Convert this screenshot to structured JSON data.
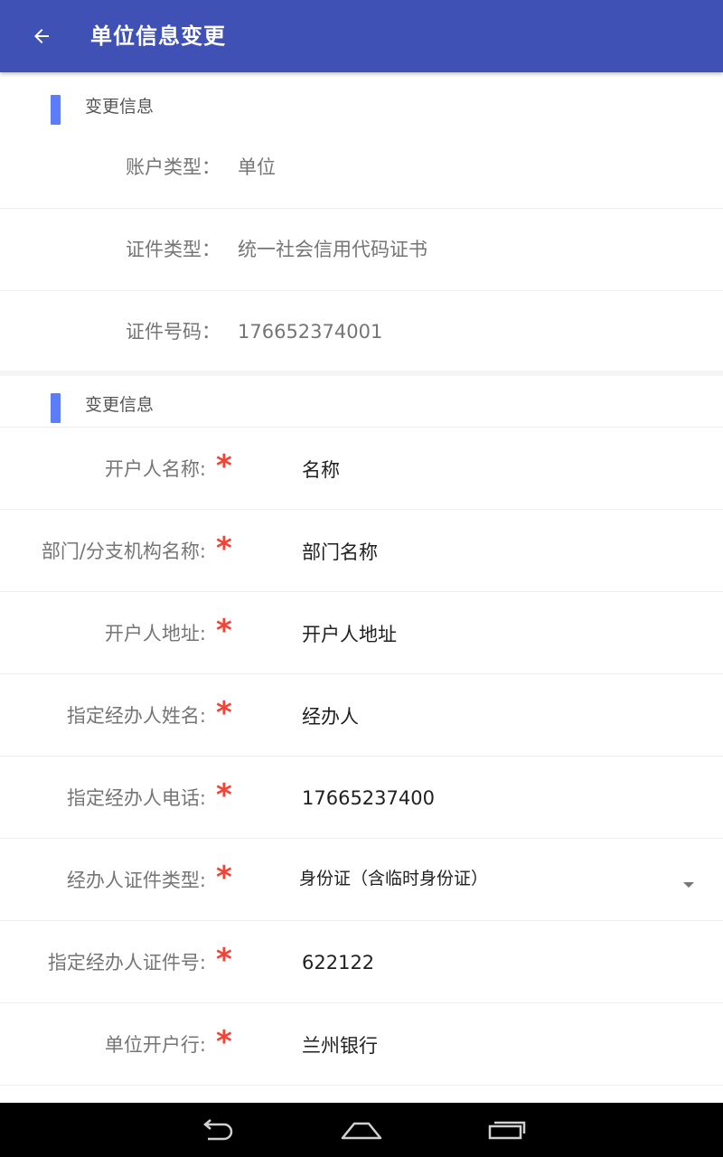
{
  "app_bar": {
    "back_icon": "arrow-left-icon",
    "title": "单位信息变更",
    "background": "#3f51b5"
  },
  "section_info": {
    "title": "变更信息",
    "rows": [
      {
        "label": "账户类型：",
        "value": "单位"
      },
      {
        "label": "证件类型：",
        "value": "统一社会信用代码证书"
      },
      {
        "label": "证件号码：",
        "value": "176652374001"
      }
    ]
  },
  "section_form": {
    "title": "变更信息",
    "required_mark": "*",
    "fields": [
      {
        "label": "开户人名称:",
        "value": "名称"
      },
      {
        "label": "部门/分支机构名称:",
        "value": "部门名称"
      },
      {
        "label": "开户人地址:",
        "value": "开户人地址"
      },
      {
        "label": "指定经办人姓名:",
        "value": "经办人"
      },
      {
        "label": "指定经办人电话:",
        "value": "17665237400"
      },
      {
        "label": "经办人证件类型:",
        "value": "身份证（含临时身份证）",
        "dropdown_icon": "triangle-down-icon"
      },
      {
        "label": "指定经办人证件号:",
        "value": "622122"
      },
      {
        "label": "单位开户行:",
        "value": "兰州银行"
      }
    ]
  },
  "nav_bar": {
    "back_icon": "nav-back-icon",
    "home_icon": "nav-home-icon",
    "recents_icon": "nav-recents-icon"
  },
  "colors": {
    "accent_bar": "#5c7cfa",
    "required": "#f44336"
  }
}
